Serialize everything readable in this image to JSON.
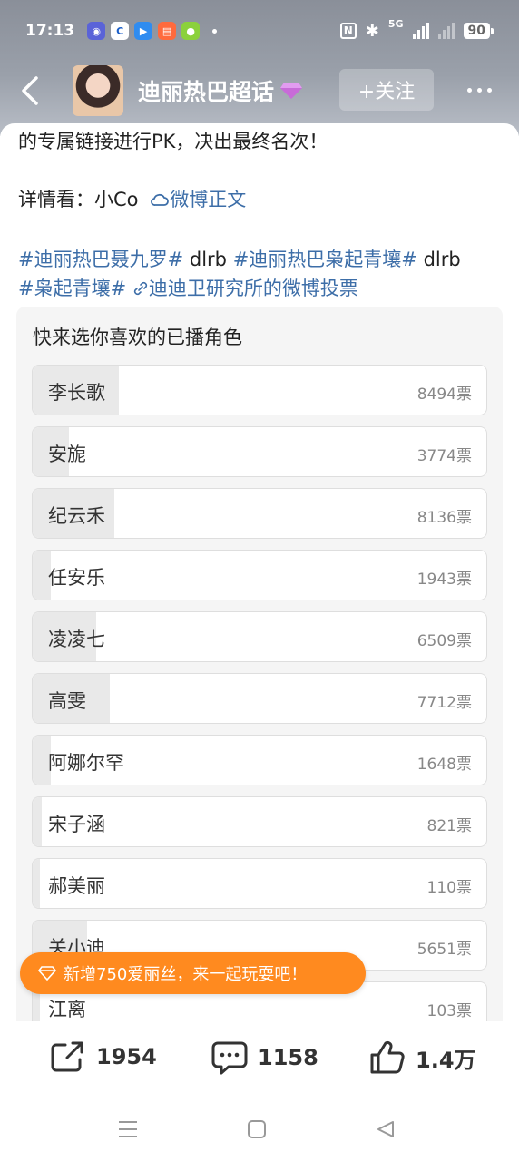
{
  "status_bar": {
    "time": "17:13",
    "network": "5G",
    "battery": "90",
    "nfc": "N"
  },
  "nav": {
    "title": "迪丽热巴超话",
    "follow_label": "+关注"
  },
  "post": {
    "line1": "的专属链接进行PK，决出最终名次！",
    "details_prefix": "详情看：小Co",
    "details_link": "微博正文",
    "line3": [
      {
        "text": "#迪丽热巴聂九罗#",
        "type": "topic"
      },
      {
        "text": " dlrb ",
        "type": "plain"
      },
      {
        "text": "#迪丽热巴枭起青壤#",
        "type": "topic"
      },
      {
        "text": " dlrb",
        "type": "plain"
      }
    ],
    "line4_topic": "#枭起青壤#",
    "line4_link": "迪迪卫研究所的微博投票"
  },
  "poll": {
    "title": "快来选你喜欢的已播角色",
    "options": [
      {
        "name": "李长歌",
        "votes": "8494票",
        "share": 0.19
      },
      {
        "name": "安旎",
        "votes": "3774票",
        "share": 0.08
      },
      {
        "name": "纪云禾",
        "votes": "8136票",
        "share": 0.18
      },
      {
        "name": "任安乐",
        "votes": "1943票",
        "share": 0.04
      },
      {
        "name": "凌凌七",
        "votes": "6509票",
        "share": 0.14
      },
      {
        "name": "高雯",
        "votes": "7712票",
        "share": 0.17
      },
      {
        "name": "阿娜尔罕",
        "votes": "1648票",
        "share": 0.04
      },
      {
        "name": "宋子涵",
        "votes": "821票",
        "share": 0.02
      },
      {
        "name": "郝美丽",
        "votes": "110票",
        "share": 0.0
      },
      {
        "name": "关小迪",
        "votes": "5651票",
        "share": 0.12
      },
      {
        "name": "江离",
        "votes": "103票",
        "share": 0.0
      }
    ]
  },
  "toast": {
    "text": "新增750爱丽丝，来一起玩耍吧！"
  },
  "actions": {
    "share_count": "1954",
    "comment_count": "1158",
    "like_count": "1.4万"
  },
  "colors": {
    "topic": "#3d6ea8",
    "toast": "#ff8a1f",
    "poll_bg": "#f5f5f5"
  }
}
